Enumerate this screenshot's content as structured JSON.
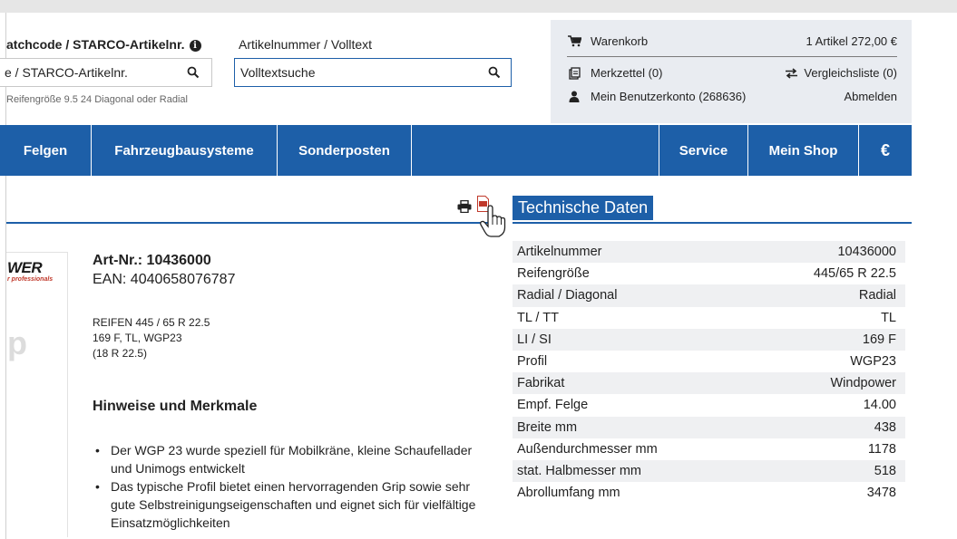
{
  "search": {
    "matchcode_label": "atchcode / STARCO-Artikelnr.",
    "matchcode_placeholder": "e / STARCO-Artikelnr.",
    "artikel_label": "Artikelnummer / Volltext",
    "volltext_placeholder": "Volltextsuche",
    "hint": "Reifengröße 9.5 24 Diagonal oder Radial"
  },
  "account": {
    "cart_label": "Warenkorb",
    "cart_summary": "1 Artikel  272,00 €",
    "merkzettel": "Merkzettel (0)",
    "vergleichsliste": "Vergleichsliste (0)",
    "benutzerkonto": "Mein Benutzerkonto (268636)",
    "abmelden": "Abmelden"
  },
  "nav": {
    "felgen": "Felgen",
    "fahrzeugbausysteme": "Fahrzeugbausysteme",
    "sonderposten": "Sonderposten",
    "service": "Service",
    "mein_shop": "Mein Shop",
    "currency": "€"
  },
  "logo": {
    "text": "WER",
    "sub": "r professionals",
    "fragment": "p"
  },
  "product": {
    "art_nr": "Art-Nr.: 10436000",
    "ean": "EAN: 4040658076787",
    "desc_line1": "REIFEN 445 / 65 R 22.5",
    "desc_line2": "169 F, TL, WGP23",
    "desc_line3": "(18 R 22.5)",
    "hinweise_title": "Hinweise und Merkmale",
    "bullets": [
      "Der WGP 23 wurde speziell für Mobilkräne, kleine Schaufellader und Unimogs entwickelt",
      "Das typische Profil bietet einen hervorragenden Grip sowie sehr gute Selbstreinigungseigenschaften und eignet sich für vielfältige Einsatzmöglichkeiten"
    ]
  },
  "tech": {
    "title": "Technische Daten",
    "rows": [
      {
        "label": "Artikelnummer",
        "value": "10436000"
      },
      {
        "label": "Reifengröße",
        "value": "445/65 R 22.5"
      },
      {
        "label": "Radial / Diagonal",
        "value": "Radial"
      },
      {
        "label": "TL / TT",
        "value": "TL"
      },
      {
        "label": "LI / SI",
        "value": "169 F"
      },
      {
        "label": "Profil",
        "value": "WGP23"
      },
      {
        "label": "Fabrikat",
        "value": "Windpower"
      },
      {
        "label": "Empf. Felge",
        "value": "14.00"
      },
      {
        "label": "Breite mm",
        "value": "438"
      },
      {
        "label": "Außendurchmesser mm",
        "value": "1178"
      },
      {
        "label": "stat. Halbmesser mm",
        "value": "518"
      },
      {
        "label": "Abrollumfang mm",
        "value": "3478"
      }
    ]
  },
  "colors": {
    "brand_blue": "#1d5fa8",
    "cart_bg": "#e9ecf1",
    "row_alt": "#eff0f2"
  }
}
